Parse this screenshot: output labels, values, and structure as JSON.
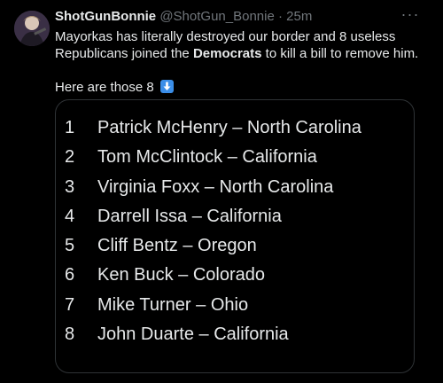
{
  "tweet": {
    "author_name": "ShotGunBonnie",
    "handle": "@ShotGun_Bonnie",
    "separator": "·",
    "time": "25m",
    "more_label": "···",
    "text_part1": "Mayorkas has literally destroyed our border and 8 useless Republicans joined the ",
    "text_bold": "Democrats",
    "text_part2": " to kill a bill to remove him.",
    "text_line3": "Here are those 8",
    "arrow_icon": "down-arrow-emoji-icon",
    "accent_color": "#3b8ee8"
  },
  "card": {
    "members": [
      {
        "num": "1",
        "name": "Patrick McHenry – North Carolina"
      },
      {
        "num": "2",
        "name": "Tom McClintock – California"
      },
      {
        "num": "3",
        "name": "Virginia Foxx – North Carolina"
      },
      {
        "num": "4",
        "name": "Darrell Issa – California"
      },
      {
        "num": "5",
        "name": "Cliff Bentz – Oregon"
      },
      {
        "num": "6",
        "name": "Ken Buck – Colorado"
      },
      {
        "num": "7",
        "name": "Mike Turner – Ohio"
      },
      {
        "num": "8",
        "name": "John Duarte – California"
      }
    ]
  }
}
